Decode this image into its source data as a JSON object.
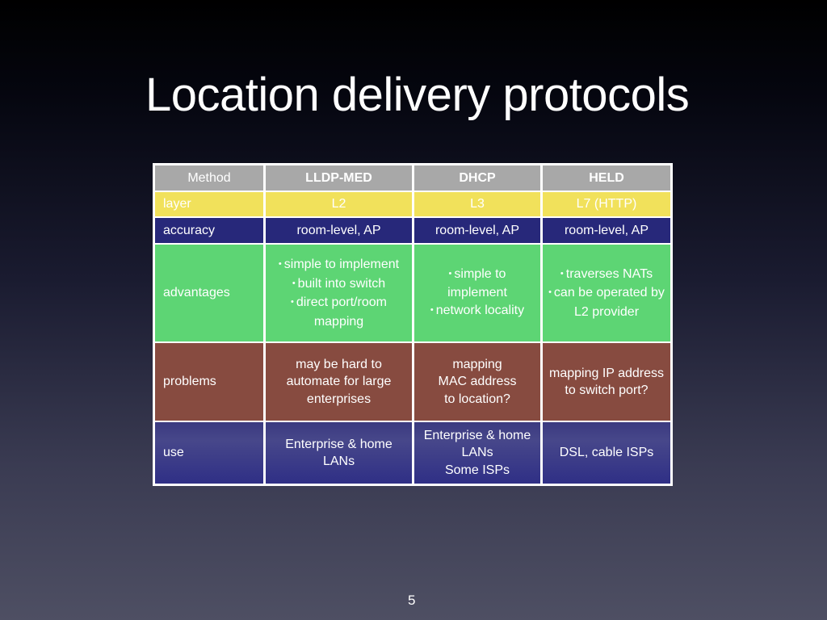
{
  "slide": {
    "title": "Location delivery protocols",
    "page_number": "5"
  },
  "table": {
    "header": {
      "label": "Method",
      "columns": [
        "LLDP-MED",
        "DHCP",
        "HELD"
      ]
    },
    "rows": [
      {
        "label": "layer",
        "cells": [
          [
            "L2"
          ],
          [
            "L3"
          ],
          [
            "L7 (HTTP)"
          ]
        ]
      },
      {
        "label": "accuracy",
        "cells": [
          [
            "room-level, AP"
          ],
          [
            "room-level, AP"
          ],
          [
            "room-level, AP"
          ]
        ]
      },
      {
        "label": "advantages",
        "cells": [
          [
            "simple to implement",
            "built into switch",
            "direct port/room mapping"
          ],
          [
            "simple to implement",
            "network locality"
          ],
          [
            "traverses NATs",
            "can be operated by L2 provider"
          ]
        ]
      },
      {
        "label": "problems",
        "cells": [
          [
            "may be hard to automate for large enterprises"
          ],
          [
            "mapping MAC address to location?"
          ],
          [
            "mapping IP address to switch port?"
          ]
        ]
      },
      {
        "label": "use",
        "cells": [
          [
            "Enterprise & home LANs"
          ],
          [
            "Enterprise & home LANs",
            "Some ISPs"
          ],
          [
            "DSL, cable ISPs"
          ]
        ]
      }
    ],
    "row_colors": {
      "header": "#a8a8a8",
      "layer": "#f1e15b",
      "accuracy": "#27287a",
      "advantages": "#5dd574",
      "problems": "#874b40",
      "use": "#2f2f86"
    }
  }
}
